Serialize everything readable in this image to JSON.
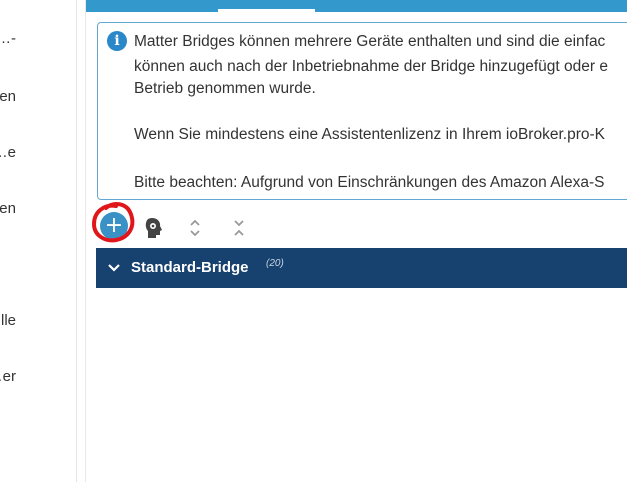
{
  "sidebar": {
    "items": [
      {
        "label": "…-"
      },
      {
        "label": "…en"
      },
      {
        "label": "…e"
      },
      {
        "label": "…rien"
      },
      {
        "label": "…lle"
      },
      {
        "label": "…er"
      }
    ]
  },
  "info": {
    "lines": [
      "Matter Bridges können mehrere Geräte enthalten und sind die einfac",
      "können auch nach der Inbetriebnahme der Bridge hinzugefügt oder e",
      "Betrieb genommen wurde.",
      "Wenn Sie mindestens eine Assistentenlizenz in Ihrem ioBroker.pro-K",
      "Bitte beachten: Aufgrund von Einschränkungen des Amazon Alexa-S"
    ]
  },
  "toolbar": {
    "add_icon": "plus-icon",
    "head_icon": "robot-head-icon",
    "expand_icon": "expand-all-icon",
    "collapse_icon": "collapse-all-icon"
  },
  "bridge": {
    "name": "Standard-Bridge",
    "count": "(20)"
  },
  "colors": {
    "topbar": "#3399cc",
    "bridge_row": "#17416e",
    "add_button": "#3a91c5",
    "annotation": "#e0161b"
  }
}
